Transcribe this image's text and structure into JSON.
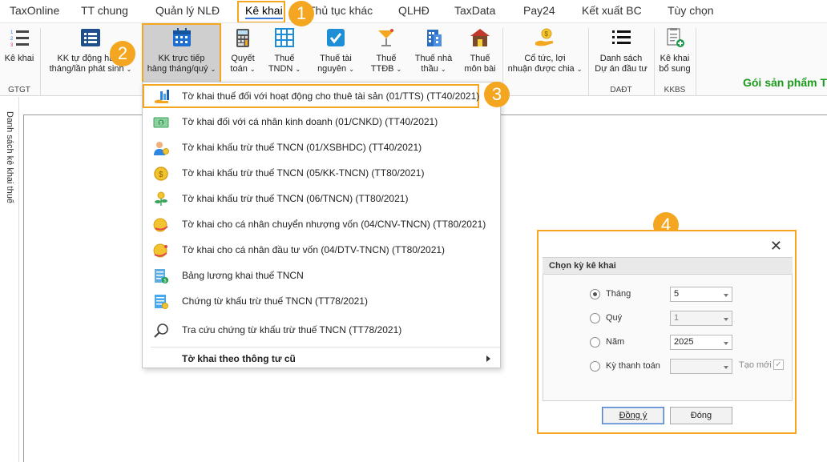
{
  "menu": {
    "items": [
      "TaxOnline",
      "TT chung",
      "Quản lý NLĐ",
      "Kê khai",
      "Thủ tục khác",
      "QLHĐ",
      "TaxData",
      "Pay24",
      "Kết xuất BC",
      "Tùy chọn"
    ]
  },
  "ribbon": {
    "buttons": [
      {
        "label1": "Kê khai",
        "label2": ""
      },
      {
        "label1": "KK tự động hàng",
        "label2": "tháng/lần phát sinh"
      },
      {
        "label1": "KK trực tiếp",
        "label2": "hàng tháng/quý"
      },
      {
        "label1": "Quyết",
        "label2": "toán"
      },
      {
        "label1": "Thuế",
        "label2": "TNDN"
      },
      {
        "label1": "Thuế tài",
        "label2": "nguyên"
      },
      {
        "label1": "Thuế",
        "label2": "TTĐB"
      },
      {
        "label1": "Thuế nhà",
        "label2": "thầu"
      },
      {
        "label1": "Thuế",
        "label2": "môn bài"
      },
      {
        "label1": "Cổ tức, lợi",
        "label2": "nhuận được chia"
      },
      {
        "label1": "Danh sách",
        "label2": "Dự án đầu tư"
      },
      {
        "label1": "Kê khai",
        "label2": "bổ sung"
      }
    ],
    "groups": [
      "GTGT",
      "DAĐT",
      "KKBS"
    ],
    "promo": "Gói sản phẩm T"
  },
  "sidebar": {
    "label": "Danh sách kê khai thuế"
  },
  "dropdown": {
    "items": [
      "Tờ khai thuế đối với hoạt động cho thuê tài sản (01/TTS) (TT40/2021)",
      "Tờ khai đối với cá nhân kinh doanh (01/CNKD) (TT40/2021)",
      "Tờ khai khấu trừ thuế TNCN (01/XSBHDC) (TT40/2021)",
      "Tờ khai khấu trừ thuế TNCN (05/KK-TNCN) (TT80/2021)",
      "Tờ khai khấu trừ thuế TNCN (06/TNCN) (TT80/2021)",
      "Tờ khai cho cá nhân chuyển nhượng vốn (04/CNV-TNCN) (TT80/2021)",
      "Tờ khai cho cá nhân đầu tư vốn (04/DTV-TNCN) (TT80/2021)",
      "Bảng lương khai thuế TNCN",
      "Chứng từ khấu trừ thuế TNCN (TT78/2021)",
      "Tra cứu chứng từ khấu trừ thuế TNCN (TT78/2021)"
    ],
    "submenu": "Tờ khai theo thông tư cũ"
  },
  "badges": [
    "1",
    "2",
    "3",
    "4"
  ],
  "dialog": {
    "title": "Chọn kỳ kê khai",
    "options": [
      {
        "label": "Tháng",
        "value": "5",
        "selected": true
      },
      {
        "label": "Quý",
        "value": "1",
        "selected": false
      },
      {
        "label": "Năm",
        "value": "2025",
        "selected": false
      },
      {
        "label": "Kỳ thanh toán",
        "value": "",
        "selected": false
      }
    ],
    "new_label": "Tạo mới",
    "ok_label": "Đồng ý",
    "close_label": "Đóng"
  },
  "colors": {
    "highlight": "#f4a621",
    "promo": "#1a9a1a"
  }
}
